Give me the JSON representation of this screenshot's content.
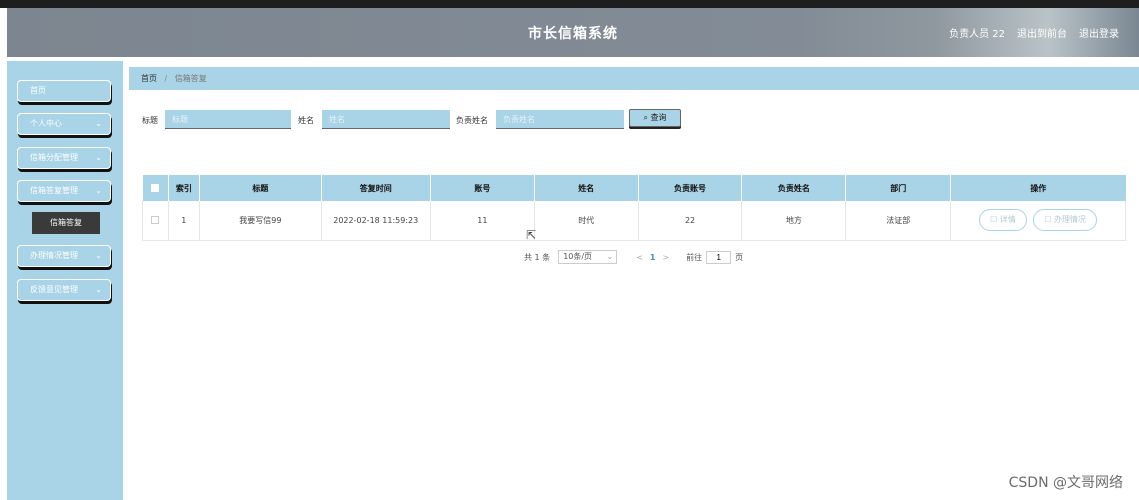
{
  "header": {
    "title": "市长信箱系统",
    "user": "负责人员 22",
    "back_link": "退出到前台",
    "logout_link": "退出登录"
  },
  "sidebar": {
    "items": [
      {
        "label": "首页",
        "has_chevron": false
      },
      {
        "label": "个人中心",
        "chevron": "⌄"
      },
      {
        "label": "信箱分配管理",
        "chevron": "⌄"
      },
      {
        "label": "信箱答复管理",
        "chevron": "⌄"
      },
      {
        "label": "办理情况管理",
        "chevron": "⌄"
      },
      {
        "label": "反馈意见管理",
        "chevron": "⌄"
      }
    ],
    "active_sub": "信箱答复"
  },
  "breadcrumb": {
    "home": "首页",
    "separator": "/",
    "current": "信箱答复"
  },
  "search": {
    "title_label": "标题",
    "title_placeholder": "标题",
    "name_label": "姓名",
    "name_placeholder": "姓名",
    "owner_label": "负责姓名",
    "owner_placeholder": "负责姓名",
    "button_label": "查询",
    "button_icon": "search-icon"
  },
  "table": {
    "columns": [
      "索引",
      "标题",
      "答复时间",
      "账号",
      "姓名",
      "负责账号",
      "负责姓名",
      "部门",
      "操作"
    ],
    "rows": [
      {
        "index": "1",
        "title": "我要写信99",
        "reply_time": "2022-02-18 11:59:23",
        "account": "11",
        "name": "时代",
        "owner_account": "22",
        "owner_name": "地方",
        "dept": "法证部",
        "detail_btn": "详情",
        "handle_btn": "办理情况"
      }
    ]
  },
  "pager": {
    "total": "共 1 条",
    "page_size": "10条/页",
    "prev": "<",
    "current": "1",
    "next": ">",
    "goto_label": "前往",
    "goto_value": "1",
    "page_suffix": "页"
  },
  "watermark": "CSDN @文哥网络",
  "colors": {
    "accent": "#a9d3e6",
    "header": "#838c96",
    "submenu": "#3a3a3a"
  }
}
